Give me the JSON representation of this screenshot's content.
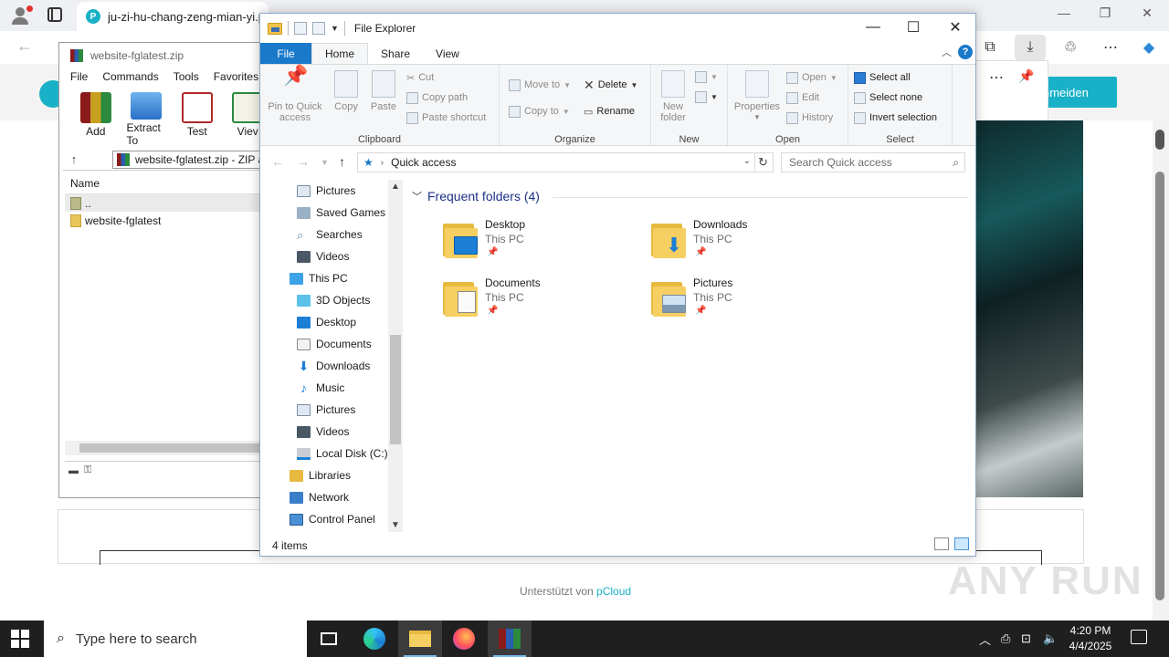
{
  "browser": {
    "tab_title": "ju-zi-hu-chang-zeng-mian-yi.p",
    "tab_favicon_letter": "P",
    "anmelden_button": "nmeiden",
    "footer_prefix": "Unterstützt von",
    "footer_link": "pCloud",
    "watermark": "ANY RUN",
    "accent_color": "#19b1c7"
  },
  "winrar": {
    "title": "website-fglatest.zip",
    "menu": [
      "File",
      "Commands",
      "Tools",
      "Favorites"
    ],
    "tools": [
      {
        "label": "Add",
        "icon": "add-archive-icon"
      },
      {
        "label": "Extract To",
        "icon": "extract-icon"
      },
      {
        "label": "Test",
        "icon": "test-icon"
      },
      {
        "label": "Viev",
        "icon": "view-icon"
      }
    ],
    "path": "website-fglatest.zip - ZIP a",
    "column_name": "Name",
    "rows": [
      {
        "name": ".."
      },
      {
        "name": "website-fglatest"
      }
    ]
  },
  "explorer": {
    "title": "File Explorer",
    "tabs": {
      "file": "File",
      "home": "Home",
      "share": "Share",
      "view": "View"
    },
    "ribbon": {
      "clipboard": {
        "label": "Clipboard",
        "pin": "Pin to Quick access",
        "copy": "Copy",
        "paste": "Paste",
        "cut": "Cut",
        "copy_path": "Copy path",
        "paste_shortcut": "Paste shortcut"
      },
      "organize": {
        "label": "Organize",
        "move_to": "Move to",
        "copy_to": "Copy to",
        "delete": "Delete",
        "rename": "Rename"
      },
      "new": {
        "label": "New",
        "new_folder": "New folder"
      },
      "open": {
        "label": "Open",
        "properties": "Properties",
        "open": "Open",
        "edit": "Edit",
        "history": "History"
      },
      "select": {
        "label": "Select",
        "select_all": "Select all",
        "select_none": "Select none",
        "invert": "Invert selection"
      }
    },
    "address": "Quick access",
    "search_placeholder": "Search Quick access",
    "nav": [
      {
        "label": "Pictures",
        "icon": "pictures-icon"
      },
      {
        "label": "Saved Games",
        "icon": "saved-games-icon"
      },
      {
        "label": "Searches",
        "icon": "searches-icon"
      },
      {
        "label": "Videos",
        "icon": "videos-icon"
      },
      {
        "label": "This PC",
        "icon": "this-pc-icon"
      },
      {
        "label": "3D Objects",
        "icon": "3d-objects-icon"
      },
      {
        "label": "Desktop",
        "icon": "desktop-icon"
      },
      {
        "label": "Documents",
        "icon": "documents-icon"
      },
      {
        "label": "Downloads",
        "icon": "downloads-icon"
      },
      {
        "label": "Music",
        "icon": "music-icon"
      },
      {
        "label": "Pictures",
        "icon": "pictures-icon"
      },
      {
        "label": "Videos",
        "icon": "videos-icon"
      },
      {
        "label": "Local Disk (C:)",
        "icon": "local-disk-icon"
      },
      {
        "label": "Libraries",
        "icon": "libraries-icon"
      },
      {
        "label": "Network",
        "icon": "network-icon"
      },
      {
        "label": "Control Panel",
        "icon": "control-panel-icon"
      }
    ],
    "group_header": "Frequent folders (4)",
    "folders": [
      {
        "name": "Desktop",
        "location": "This PC"
      },
      {
        "name": "Downloads",
        "location": "This PC"
      },
      {
        "name": "Documents",
        "location": "This PC"
      },
      {
        "name": "Pictures",
        "location": "This PC"
      }
    ],
    "status": "4 items"
  },
  "taskbar": {
    "search_placeholder": "Type here to search",
    "time": "4:20 PM",
    "date": "4/4/2025"
  }
}
